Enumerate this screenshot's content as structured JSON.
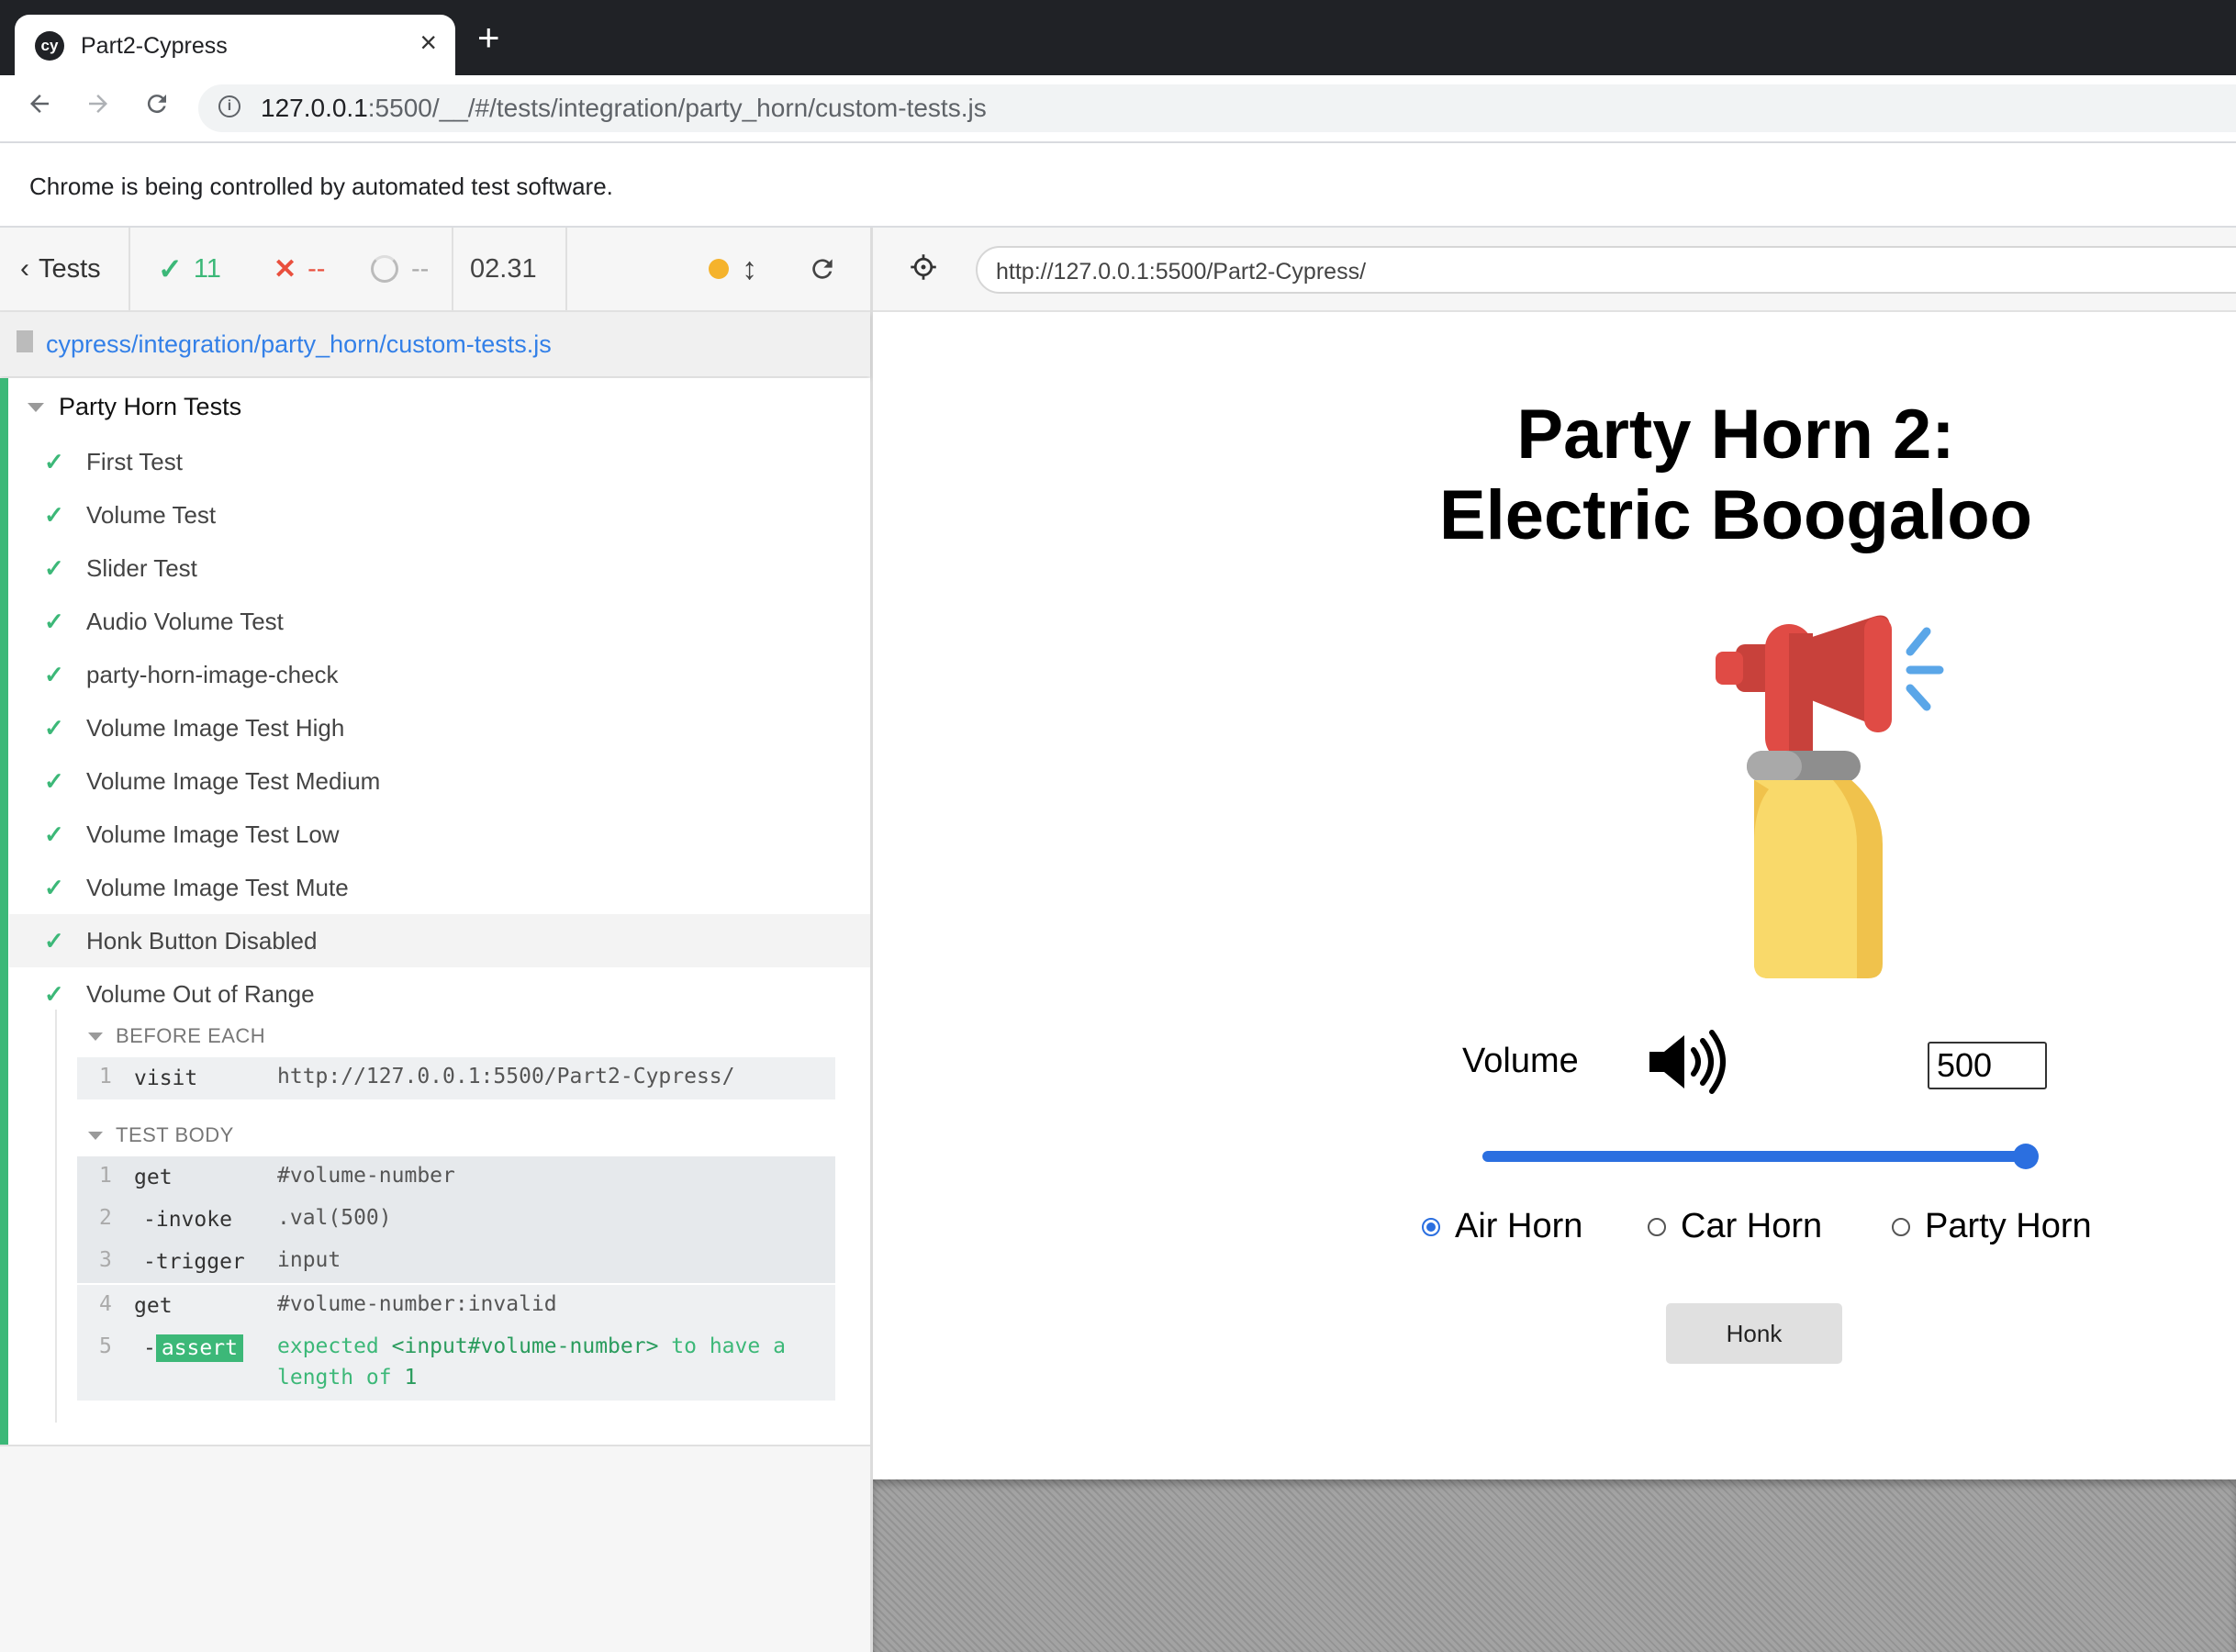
{
  "browser": {
    "tab_title": "Part2-Cypress",
    "favicon_text": "cy",
    "url_host": "127.0.0.1",
    "url_rest": ":5500/__/#/tests/integration/party_horn/custom-tests.js",
    "infobar": "Chrome is being controlled by automated test software."
  },
  "reporter": {
    "back_label": "Tests",
    "passed": "11",
    "failed": "--",
    "pending": "--",
    "duration": "02.31",
    "file_path": "cypress/integration/party_horn/custom-tests.js",
    "suite_title": "Party Horn Tests",
    "tests": [
      "First Test",
      "Volume Test",
      "Slider Test",
      "Audio Volume Test",
      "party-horn-image-check",
      "Volume Image Test High",
      "Volume Image Test Medium",
      "Volume Image Test Low",
      "Volume Image Test Mute",
      "Honk Button Disabled",
      "Volume Out of Range"
    ],
    "before_each": {
      "title": "BEFORE EACH",
      "commands": [
        {
          "num": "1",
          "name": "visit",
          "message": "http://127.0.0.1:5500/Part2-Cypress/"
        }
      ]
    },
    "test_body": {
      "title": "TEST BODY",
      "commands": [
        {
          "num": "1",
          "name": "get",
          "message": "#volume-number"
        },
        {
          "num": "2",
          "name": "-invoke",
          "message": ".val(500)"
        },
        {
          "num": "3",
          "name": "-trigger",
          "message": "input"
        },
        {
          "num": "4",
          "name": "get",
          "message": "#volume-number:invalid"
        },
        {
          "num": "5",
          "name": "assert",
          "prefix": "-",
          "msg_part1": "expected",
          "msg_part2": "<input#volume-number>",
          "msg_part3": "to have a",
          "msg_part4": "length of",
          "msg_part5": "1"
        }
      ]
    }
  },
  "aut": {
    "url": "http://127.0.0.1:5500/Part2-Cypress/",
    "title_line1": "Party Horn 2:",
    "title_line2": "Electric Boogaloo",
    "volume_label": "Volume",
    "volume_value": "500",
    "slider_level_fraction": 1.0,
    "sound_options": [
      "Air Horn",
      "Car Horn",
      "Party Horn"
    ],
    "selected_sound": "Air Horn",
    "honk_label": "Honk"
  },
  "colors": {
    "pass": "#3cb878",
    "link": "#3380e8",
    "accent": "#2b6fe0",
    "fail": "#e94f3d",
    "running": "#f5b32c"
  },
  "icons": [
    "back-arrow-icon",
    "forward-arrow-icon",
    "reload-icon",
    "info-icon",
    "check-icon",
    "fail-x-icon",
    "pending-circle-icon",
    "running-dot-icon",
    "resize-arrows-icon",
    "restart-icon",
    "crosshair-icon",
    "file-icon",
    "speaker-icon",
    "air-horn-image"
  ]
}
